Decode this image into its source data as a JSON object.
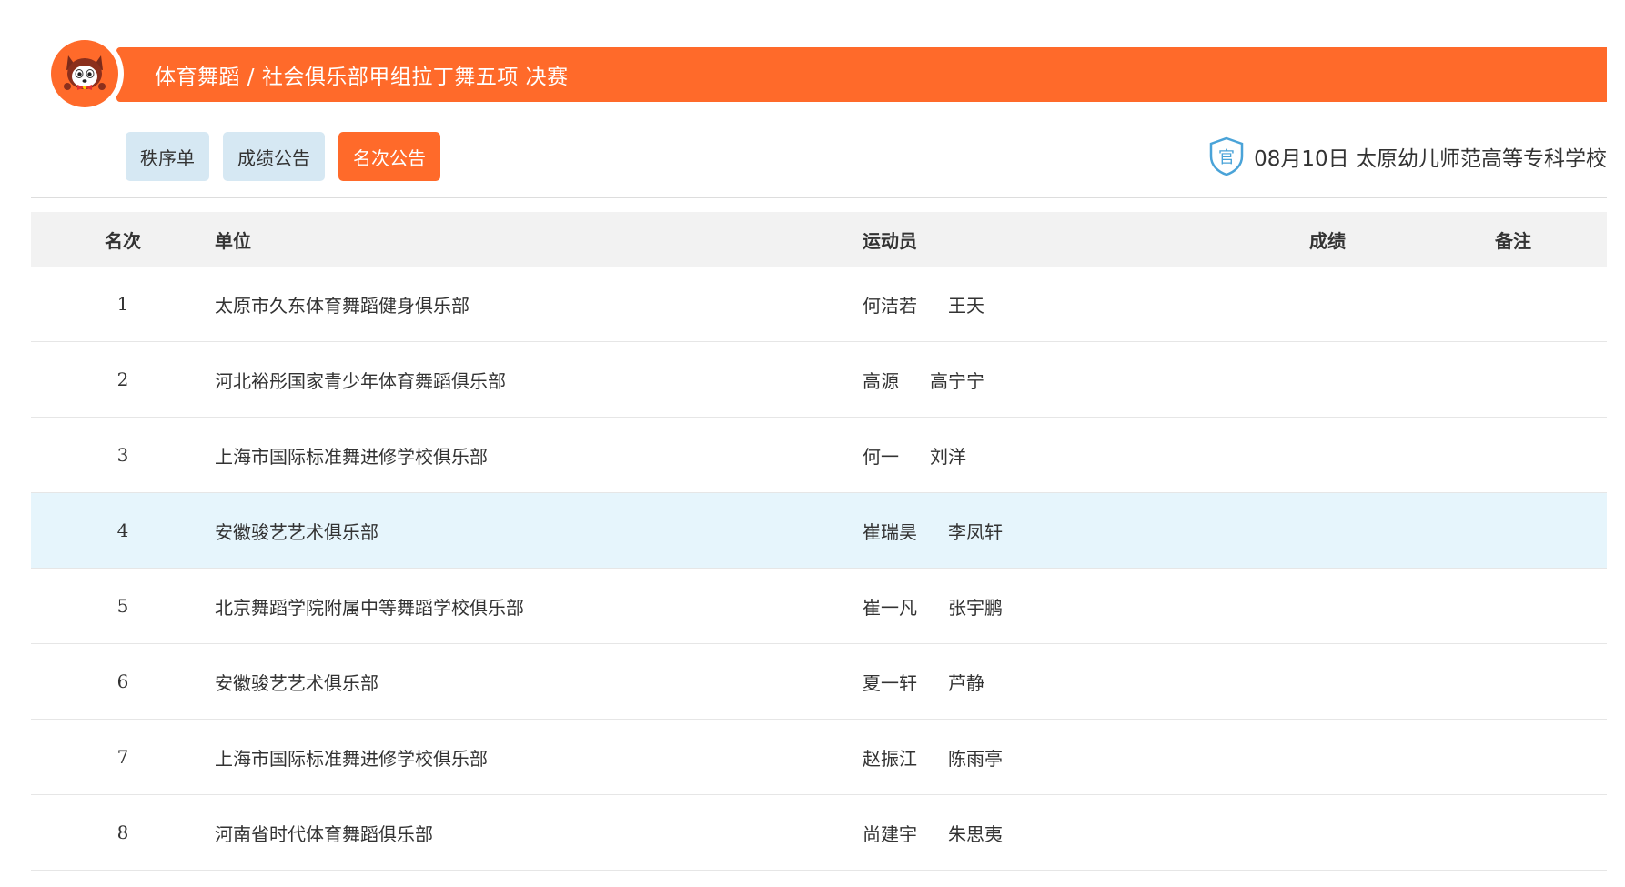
{
  "header": {
    "title": "体育舞蹈 / 社会俱乐部甲组拉丁舞五项  决赛"
  },
  "tabs": [
    {
      "label": "秩序单",
      "active": false
    },
    {
      "label": "成绩公告",
      "active": false
    },
    {
      "label": "名次公告",
      "active": true
    }
  ],
  "venue": {
    "badge": "官",
    "text": "08月10日 太原幼儿师范高等专科学校"
  },
  "colors": {
    "accent": "#ff6a2a",
    "tab_bg": "#d6e8f3",
    "highlight_row": "#e6f5fc"
  },
  "table": {
    "headers": {
      "rank": "名次",
      "unit": "单位",
      "athletes": "运动员",
      "score": "成绩",
      "note": "备注"
    },
    "rows": [
      {
        "rank": "1",
        "unit": "太原市久东体育舞蹈健身俱乐部",
        "athlete1": "何洁若",
        "athlete2": "王天",
        "score": "",
        "note": ""
      },
      {
        "rank": "2",
        "unit": "河北裕彤国家青少年体育舞蹈俱乐部",
        "athlete1": "高源",
        "athlete2": "高宁宁",
        "score": "",
        "note": ""
      },
      {
        "rank": "3",
        "unit": "上海市国际标准舞进修学校俱乐部",
        "athlete1": "何一",
        "athlete2": "刘洋",
        "score": "",
        "note": ""
      },
      {
        "rank": "4",
        "unit": "安徽骏艺艺术俱乐部",
        "athlete1": "崔瑞昊",
        "athlete2": "李凤轩",
        "score": "",
        "note": ""
      },
      {
        "rank": "5",
        "unit": "北京舞蹈学院附属中等舞蹈学校俱乐部",
        "athlete1": "崔一凡",
        "athlete2": "张宇鹏",
        "score": "",
        "note": ""
      },
      {
        "rank": "6",
        "unit": "安徽骏艺艺术俱乐部",
        "athlete1": "夏一轩",
        "athlete2": "芦静",
        "score": "",
        "note": ""
      },
      {
        "rank": "7",
        "unit": "上海市国际标准舞进修学校俱乐部",
        "athlete1": "赵振江",
        "athlete2": "陈雨亭",
        "score": "",
        "note": ""
      },
      {
        "rank": "8",
        "unit": "河南省时代体育舞蹈俱乐部",
        "athlete1": "尚建宇",
        "athlete2": "朱思夷",
        "score": "",
        "note": ""
      }
    ]
  }
}
